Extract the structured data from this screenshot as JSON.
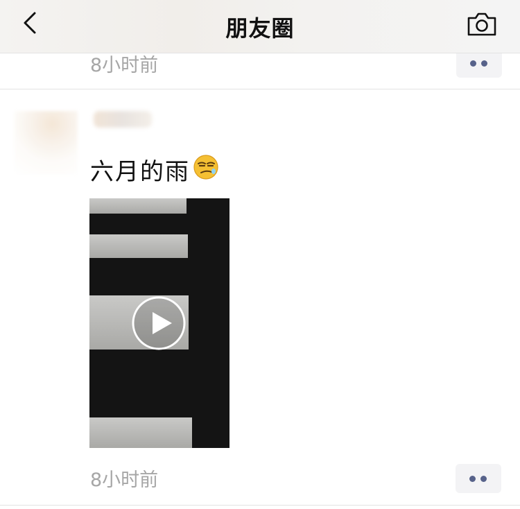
{
  "header": {
    "title": "朋友圈"
  },
  "posts": [
    {
      "time": "8小时前"
    },
    {
      "text": "六月的雨",
      "time": "8小时前"
    }
  ],
  "icons": {
    "back": "chevron-left",
    "camera": "camera",
    "emoji": "smirk-face",
    "play": "play",
    "more": "more-dots"
  }
}
